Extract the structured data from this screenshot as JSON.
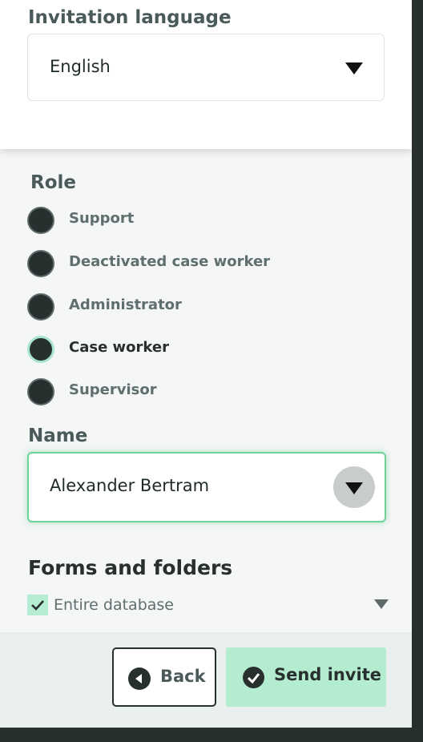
{
  "invitation": {
    "label": "Invitation language",
    "value": "English"
  },
  "role": {
    "label": "Role",
    "options": [
      {
        "label": "Support",
        "checked": false
      },
      {
        "label": "Deactivated case worker",
        "checked": false
      },
      {
        "label": "Administrator",
        "checked": false
      },
      {
        "label": "Case worker",
        "checked": true
      },
      {
        "label": "Supervisor",
        "checked": false
      }
    ]
  },
  "name": {
    "label": "Name",
    "value": "Alexander Bertram"
  },
  "forms": {
    "heading": "Forms and folders",
    "entire_database_label": "Entire database",
    "entire_database_checked": true
  },
  "footer": {
    "back_label": "Back",
    "send_label": "Send invite"
  },
  "colors": {
    "accent": "#b4ecd0",
    "focus_border": "#6fd29a",
    "dark": "#27302f"
  }
}
